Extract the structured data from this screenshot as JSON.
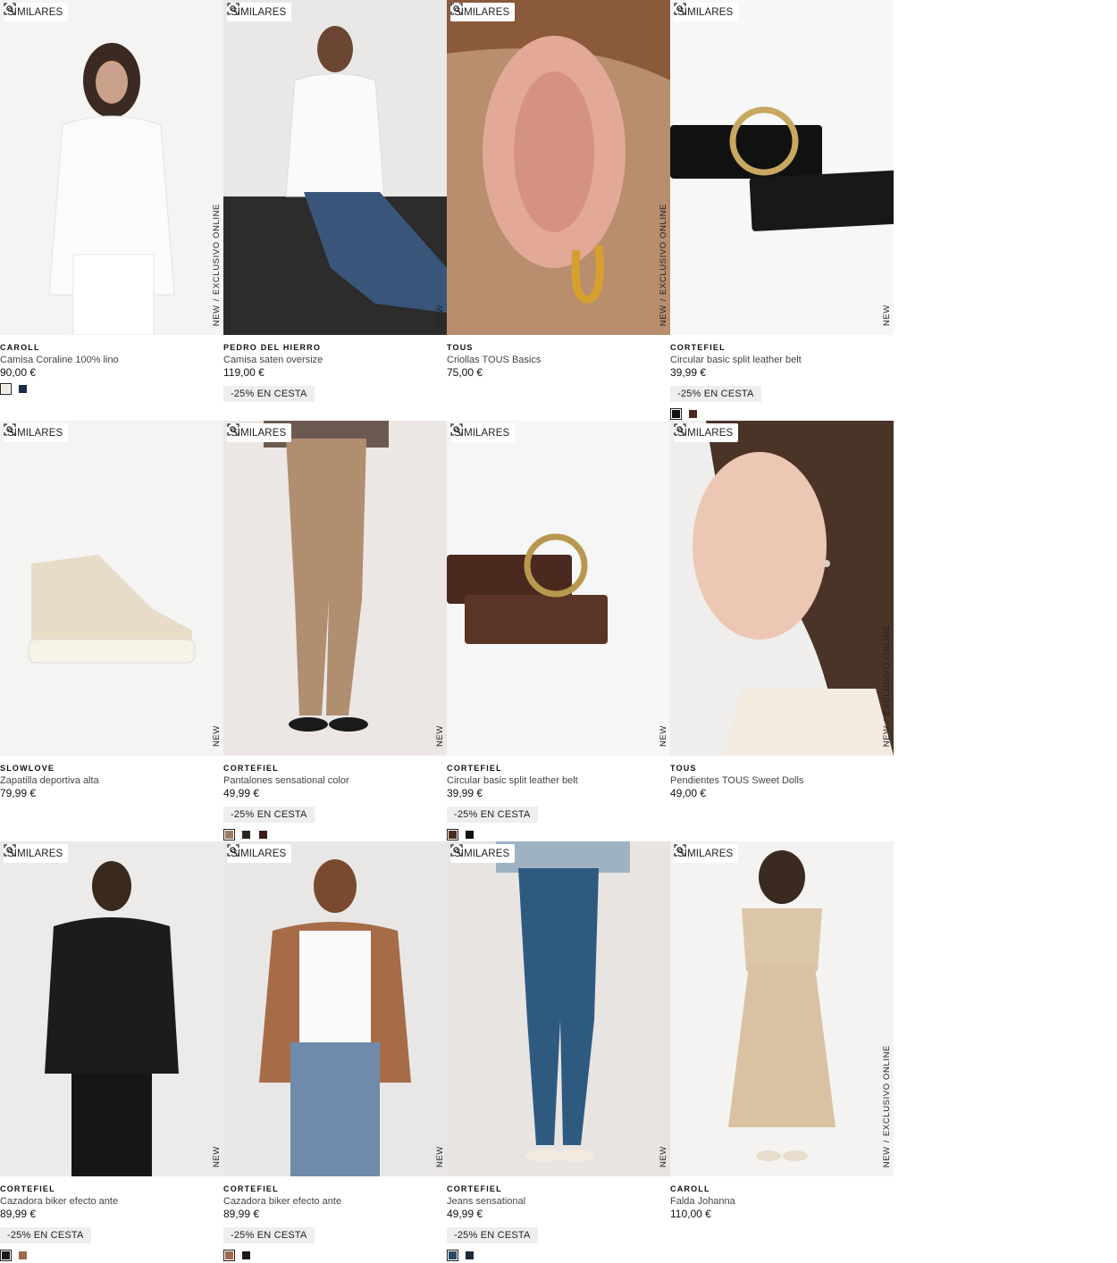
{
  "similar_label": "SIMILARES",
  "products": [
    {
      "brand": "CAROLL",
      "name": "Camisa Coraline 100% lino",
      "price": "90,00 €",
      "promo": "",
      "badge": "NEW",
      "badge2": "EXCLUSIVO ONLINE",
      "swatches": [
        "#efe9df",
        "#1c2a4a"
      ],
      "image": "white-linen-shirt-photo"
    },
    {
      "brand": "PEDRO DEL HIERRO",
      "name": "Camisa saten oversize",
      "price": "119,00 €",
      "promo": "-25% EN CESTA",
      "badge": "NEW",
      "badge2": "",
      "swatches": [],
      "image": "white-satin-shirt-photo"
    },
    {
      "brand": "TOUS",
      "name": "Criollas TOUS Basics",
      "price": "75,00 €",
      "promo": "",
      "badge": "NEW",
      "badge2": "EXCLUSIVO ONLINE",
      "swatches": [],
      "image": "gold-hoop-earring-photo"
    },
    {
      "brand": "CORTEFIEL",
      "name": "Circular basic split leather belt",
      "price": "39,99 €",
      "promo": "-25% EN CESTA",
      "badge": "NEW",
      "badge2": "",
      "swatches": [
        "#111111",
        "#4a2a1e"
      ],
      "image": "black-belt-photo"
    },
    {
      "brand": "SLOWLOVE",
      "name": "Zapatilla deportiva alta",
      "price": "79,99 €",
      "promo": "",
      "badge": "NEW",
      "badge2": "",
      "swatches": [],
      "image": "beige-hightop-sneaker-photo"
    },
    {
      "brand": "CORTEFIEL",
      "name": "Pantalones sensational color",
      "price": "49,99 €",
      "promo": "-25% EN CESTA",
      "badge": "NEW",
      "badge2": "",
      "swatches": [
        "#9e7c63",
        "#2b2320",
        "#3a1a1a"
      ],
      "image": "camel-trousers-photo"
    },
    {
      "brand": "CORTEFIEL",
      "name": "Circular basic split leather belt",
      "price": "39,99 €",
      "promo": "-25% EN CESTA",
      "badge": "NEW",
      "badge2": "",
      "swatches": [
        "#4a2a1e",
        "#111111"
      ],
      "image": "brown-belt-photo"
    },
    {
      "brand": "TOUS",
      "name": "Pendientes TOUS Sweet Dolls",
      "price": "49,00 €",
      "promo": "",
      "badge": "NEW",
      "badge2": "EXCLUSIVO ONLINE",
      "swatches": [],
      "image": "stud-earring-photo"
    },
    {
      "brand": "CORTEFIEL",
      "name": "Cazadora biker efecto ante",
      "price": "89,99 €",
      "promo": "-25% EN CESTA",
      "badge": "NEW",
      "badge2": "",
      "swatches": [
        "#1a1a1a",
        "#a0694a"
      ],
      "image": "black-biker-jacket-photo"
    },
    {
      "brand": "CORTEFIEL",
      "name": "Cazadora biker efecto ante",
      "price": "89,99 €",
      "promo": "-25% EN CESTA",
      "badge": "NEW",
      "badge2": "",
      "swatches": [
        "#a0694a",
        "#1a1a1a"
      ],
      "image": "tan-biker-jacket-photo"
    },
    {
      "brand": "CORTEFIEL",
      "name": "Jeans sensational",
      "price": "49,99 €",
      "promo": "-25% EN CESTA",
      "badge": "NEW",
      "badge2": "",
      "swatches": [
        "#2a4a66",
        "#1a2a3a"
      ],
      "image": "blue-jeans-photo"
    },
    {
      "brand": "CAROLL",
      "name": "Falda Johanna",
      "price": "110,00 €",
      "promo": "",
      "badge": "NEW",
      "badge2": "EXCLUSIVO ONLINE",
      "swatches": [],
      "image": "beige-skirt-set-photo"
    }
  ]
}
